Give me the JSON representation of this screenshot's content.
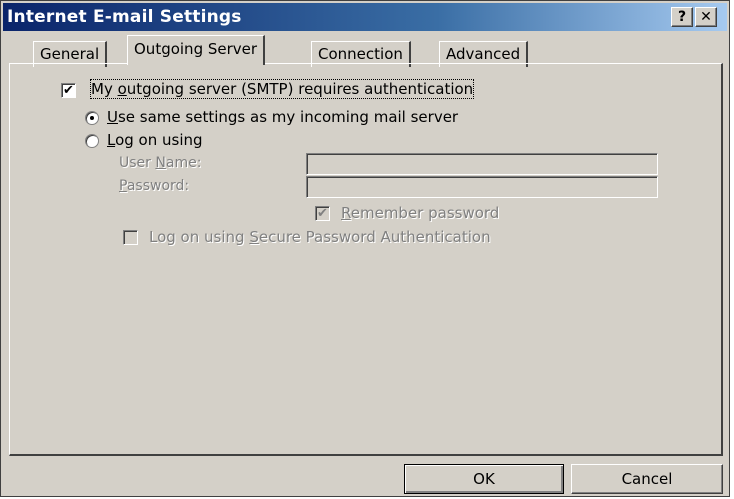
{
  "window": {
    "title": "Internet E-mail Settings",
    "help_glyph": "?",
    "close_glyph": "✕"
  },
  "tabs": [
    {
      "label": "General",
      "active": false
    },
    {
      "label": "Outgoing Server",
      "active": true
    },
    {
      "label": "Connection",
      "active": false
    },
    {
      "label": "Advanced",
      "active": false
    }
  ],
  "smtp_auth": {
    "label_pre": "My ",
    "label_accel": "o",
    "label_post": "utgoing server (SMTP) requires authentication",
    "checked": true,
    "check_glyph": "✔"
  },
  "radio_same": {
    "label_accel": "U",
    "label_post": "se same settings as my incoming mail server",
    "selected": true
  },
  "radio_logon": {
    "label_accel": "L",
    "label_post": "og on using",
    "selected": false
  },
  "username": {
    "label_pre": "User ",
    "label_accel": "N",
    "label_post": "ame:",
    "value": ""
  },
  "password": {
    "label_pre": "",
    "label_accel": "P",
    "label_post": "assword:",
    "value": ""
  },
  "remember": {
    "label_accel": "R",
    "label_post": "emember password",
    "checked": true,
    "check_glyph": "✔"
  },
  "spa": {
    "label_pre": "Log on using ",
    "label_accel": "S",
    "label_post": "ecure Password Authentication",
    "checked": false
  },
  "buttons": {
    "ok": "OK",
    "cancel": "Cancel"
  }
}
